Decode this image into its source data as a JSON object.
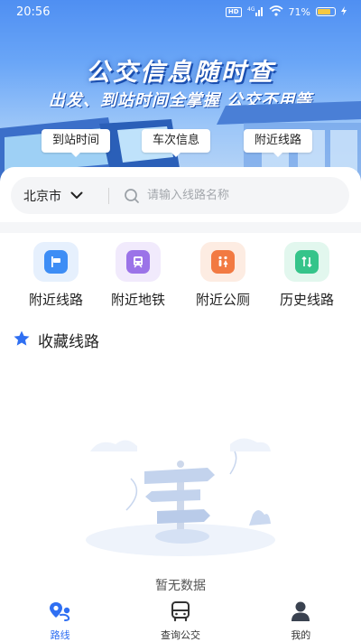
{
  "status_bar": {
    "time": "20:56",
    "hd_chip": "HD",
    "signal_text": "4G",
    "battery_text": "71%"
  },
  "hero": {
    "title": "公交信息随时查",
    "subtitle": "出发、到站时间全掌握 公交不用等",
    "tags": [
      "到站时间",
      "车次信息",
      "附近线路"
    ]
  },
  "search": {
    "city": "北京市",
    "placeholder": "请输入线路名称",
    "value": ""
  },
  "quick_entries": [
    {
      "label": "附近线路",
      "icon": "route-sign-icon",
      "color": "#3d8df5"
    },
    {
      "label": "附近地铁",
      "icon": "metro-icon",
      "color": "#9b73e8"
    },
    {
      "label": "附近公厕",
      "icon": "restroom-icon",
      "color": "#f27a42"
    },
    {
      "label": "历史线路",
      "icon": "history-route-icon",
      "color": "#35c48a"
    }
  ],
  "favorites": {
    "title": "收藏线路",
    "empty_text": "暂无数据"
  },
  "tabbar": {
    "active_index": 0,
    "items": [
      {
        "label": "路线",
        "icon": "route-icon"
      },
      {
        "label": "查询公交",
        "icon": "bus-icon"
      },
      {
        "label": "我的",
        "icon": "user-icon"
      }
    ]
  },
  "colors": {
    "accent": "#2f6ff2",
    "hero_top": "#4f8ff2",
    "favorite_star": "#2f6ff2"
  }
}
